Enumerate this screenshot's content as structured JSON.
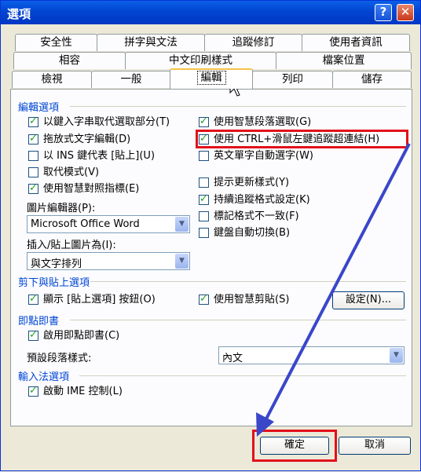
{
  "window": {
    "title": "選項"
  },
  "titlebar": {
    "help_glyph": "?",
    "close_glyph": "✕"
  },
  "tabs": {
    "row1": [
      "安全性",
      "拼字與文法",
      "追蹤修訂",
      "使用者資訊"
    ],
    "row2": [
      "相容",
      "中文印刷樣式",
      "檔案位置"
    ],
    "row3": [
      "檢視",
      "一般",
      "編輯",
      "列印",
      "儲存"
    ],
    "selected": "編輯"
  },
  "editing": {
    "header": "編輯選項",
    "left": [
      {
        "label": "以鍵入字串取代選取部分(T)",
        "checked": true
      },
      {
        "label": "拖放式文字編輯(D)",
        "checked": true
      },
      {
        "label": "以 INS 鍵代表 [貼上](U)",
        "checked": false
      },
      {
        "label": "取代模式(V)",
        "checked": false
      },
      {
        "label": "使用智慧對照指標(E)",
        "checked": true
      }
    ],
    "right": [
      {
        "label": "使用智慧段落選取(G)",
        "checked": true
      },
      {
        "label": "使用 CTRL+滑鼠左鍵追蹤超連結(H)",
        "checked": true
      },
      {
        "label": "英文單字自動選字(W)",
        "checked": false
      },
      {
        "label": "提示更新樣式(Y)",
        "checked": false
      },
      {
        "label": "持續追蹤格式設定(K)",
        "checked": true
      },
      {
        "label": "標記格式不一致(F)",
        "checked": false
      },
      {
        "label": "鍵盤自動切換(B)",
        "checked": false
      }
    ],
    "picture_editor_label": "圖片編輯器(P):",
    "picture_editor_value": "Microsoft Office Word",
    "insert_paste_label": "插入/貼上圖片為(I):",
    "insert_paste_value": "與文字排列"
  },
  "cut_paste": {
    "header": "剪下與貼上選項",
    "show_paste_options": {
      "label": "顯示 [貼上選項] 按鈕(O)",
      "checked": true
    },
    "smart_cut_paste": {
      "label": "使用智慧剪貼(S)",
      "checked": true
    },
    "settings_button": "設定(N)..."
  },
  "click_type": {
    "header": "即點即書",
    "enable": {
      "label": "啟用即點即書(C)",
      "checked": true
    },
    "default_style_label": "預設段落樣式:",
    "default_style_value": "內文"
  },
  "ime": {
    "header": "輸入法選項",
    "enable": {
      "label": "啟動 IME 控制(L)",
      "checked": true
    }
  },
  "footer": {
    "ok": "確定",
    "cancel": "取消"
  },
  "annotation_color": "#e2101b",
  "arrow_color": "#3a47c9"
}
